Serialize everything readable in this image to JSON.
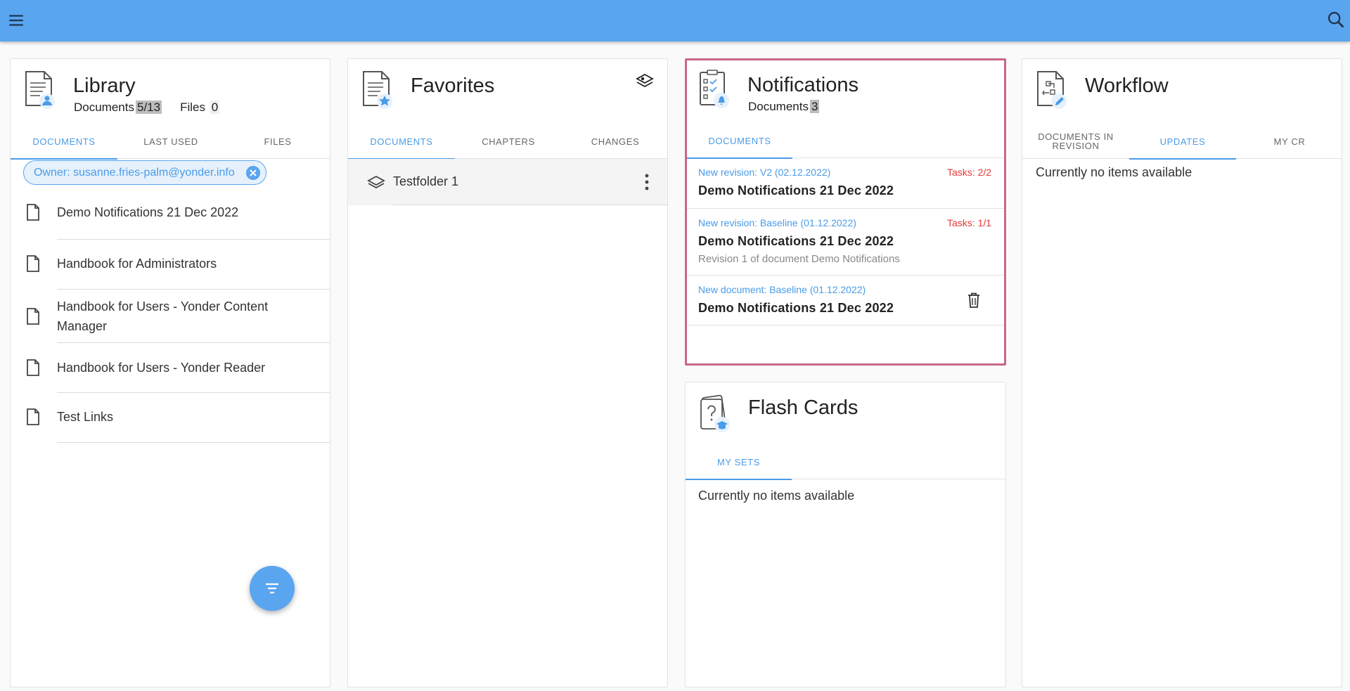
{
  "topbar": {
    "menu_icon": "menu-icon",
    "search_icon": "search-icon",
    "color": "#5aa5f0"
  },
  "library": {
    "title": "Library",
    "documents_label": "Documents",
    "documents_count": "5/13",
    "files_label": "Files",
    "files_count": "0",
    "tabs": [
      "DOCUMENTS",
      "LAST USED",
      "FILES"
    ],
    "active_tab": "DOCUMENTS",
    "filter_chip": "Owner: susanne.fries-palm@yonder.info",
    "documents": [
      "Demo Notifications 21 Dec 2022",
      "Handbook for Administrators",
      "Handbook for Users - Yonder Content Manager",
      "Handbook for Users - Yonder Reader",
      "Test Links"
    ],
    "fab_icon": "filter-icon"
  },
  "favorites": {
    "title": "Favorites",
    "tabs": [
      "DOCUMENTS",
      "CHAPTERS",
      "CHANGES"
    ],
    "active_tab": "DOCUMENTS",
    "folders": [
      "Testfolder 1"
    ]
  },
  "notifications": {
    "title": "Notifications",
    "documents_label": "Documents",
    "documents_count": "3",
    "tabs": [
      "DOCUMENTS"
    ],
    "active_tab": "DOCUMENTS",
    "items": [
      {
        "type": "New revision: V2 (02.12.2022)",
        "tasks": "Tasks: 2/2",
        "title": "Demo Notifications 21 Dec 2022",
        "subtitle": ""
      },
      {
        "type": "New revision: Baseline (01.12.2022)",
        "tasks": "Tasks: 1/1",
        "title": "Demo Notifications 21 Dec 2022",
        "subtitle": "Revision 1 of document Demo Notifications"
      },
      {
        "type": "New document: Baseline (01.12.2022)",
        "tasks": "",
        "title": "Demo Notifications 21 Dec 2022",
        "subtitle": ""
      }
    ],
    "highlight_color": "#c9668a",
    "tasks_color": "#e53935"
  },
  "flashcards": {
    "title": "Flash Cards",
    "tabs": [
      "MY SETS"
    ],
    "active_tab": "MY SETS",
    "empty_text": "Currently no items available"
  },
  "workflow": {
    "title": "Workflow",
    "tabs": [
      "DOCUMENTS IN REVISION",
      "UPDATES",
      "MY CR"
    ],
    "active_tab": "UPDATES",
    "empty_text": "Currently no items available"
  },
  "accent_color": "#4a9be8"
}
